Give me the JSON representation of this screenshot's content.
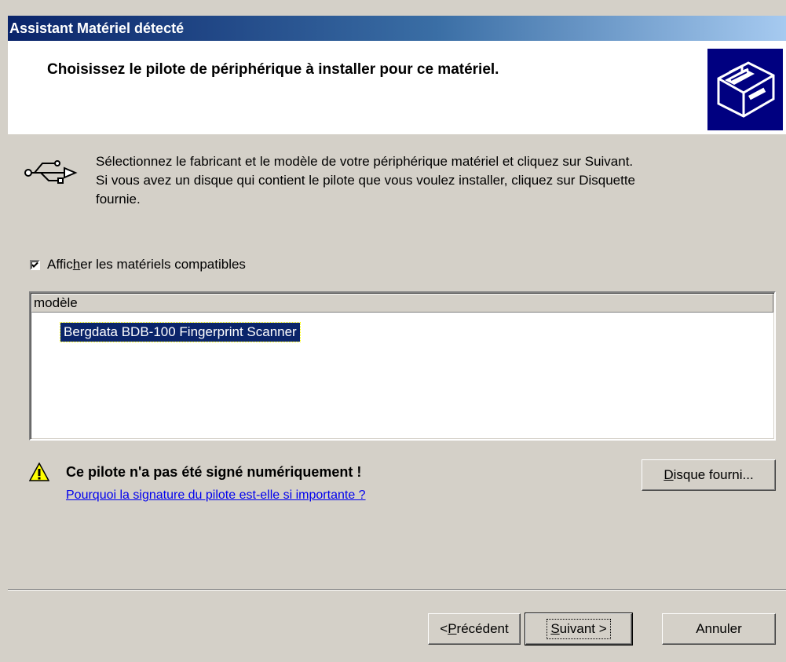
{
  "window": {
    "title": "Assistant Matériel détecté"
  },
  "header": {
    "title": "Choisissez le pilote de périphérique à installer pour ce matériel.",
    "icon": "hardware-wizard-icon"
  },
  "instructions": {
    "icon": "usb-icon",
    "line1": "Sélectionnez le fabricant et le modèle de votre périphérique matériel et cliquez sur Suivant.",
    "line2": "Si vous avez un disque qui contient le pilote que vous voulez installer, cliquez sur Disquette",
    "line3": "fournie."
  },
  "compatible_checkbox": {
    "label_pre": "Affic",
    "label_mnemonic": "h",
    "label_post": "er les matériels compatibles",
    "checked": true
  },
  "model_list": {
    "column_header": "modèle",
    "items": [
      {
        "label": "Bergdata BDB-100 Fingerprint Scanner",
        "selected": true
      }
    ]
  },
  "warning": {
    "icon": "warning-icon",
    "text": "Ce pilote n'a pas été signé numériquement !",
    "link": "Pourquoi la signature du pilote est-elle si importante ?"
  },
  "buttons": {
    "have_disk": {
      "mnemonic": "D",
      "rest": "isque fourni..."
    },
    "back": {
      "pre": "< ",
      "mnemonic": "P",
      "rest": "récédent"
    },
    "next": {
      "mnemonic": "S",
      "rest": "uivant >"
    },
    "cancel": {
      "label": "Annuler"
    }
  },
  "colors": {
    "title_bar_start": "#0a246a",
    "title_bar_end": "#a6caf0",
    "selection": "#0a246a",
    "dialog_bg": "#d4d0c8",
    "link": "#0000ee"
  }
}
